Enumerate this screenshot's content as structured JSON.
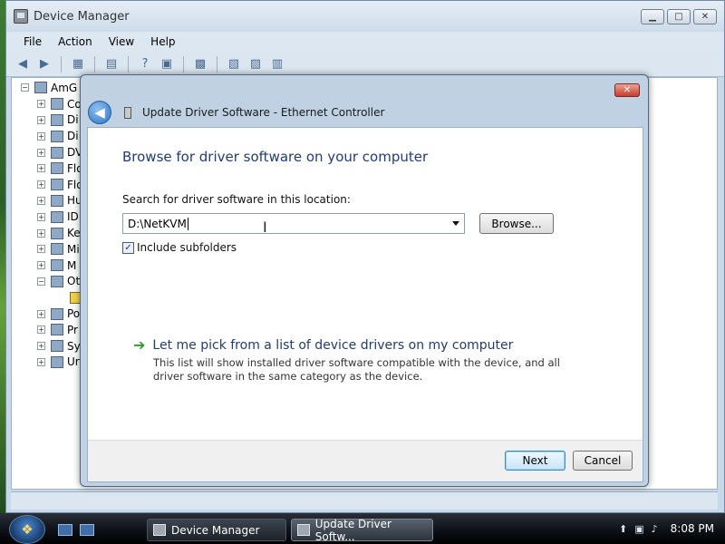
{
  "device_manager": {
    "title": "Device Manager",
    "window_controls": {
      "minimize": "▁",
      "maximize": "□",
      "close": "✕"
    },
    "menu": [
      "File",
      "Action",
      "View",
      "Help"
    ],
    "tree": {
      "root": "AmG",
      "items": [
        "Co",
        "Di",
        "Di",
        "DV",
        "Flo",
        "Flo",
        "Hu",
        "ID",
        "Ke",
        "Mi",
        "M",
        "Ot",
        "",
        "Po",
        "Pr",
        "Sy",
        "Ur"
      ]
    }
  },
  "dialog": {
    "title": "Update Driver Software - Ethernet Controller",
    "heading": "Browse for driver software on your computer",
    "search_label": "Search for driver software in this location:",
    "path_value": "D:\\NetKVM",
    "browse_label": "Browse...",
    "include_subfolders_label": "Include subfolders",
    "include_subfolders_checked": true,
    "pick_link": "Let me pick from a list of device drivers on my computer",
    "pick_description": "This list will show installed driver software compatible with the device, and all driver software in the same category as the device.",
    "next_label": "Next",
    "cancel_label": "Cancel",
    "close_glyph": "✕"
  },
  "taskbar": {
    "buttons": [
      {
        "label": "Device Manager"
      },
      {
        "label": "Update Driver Softw..."
      }
    ],
    "clock": "8:08 PM"
  }
}
